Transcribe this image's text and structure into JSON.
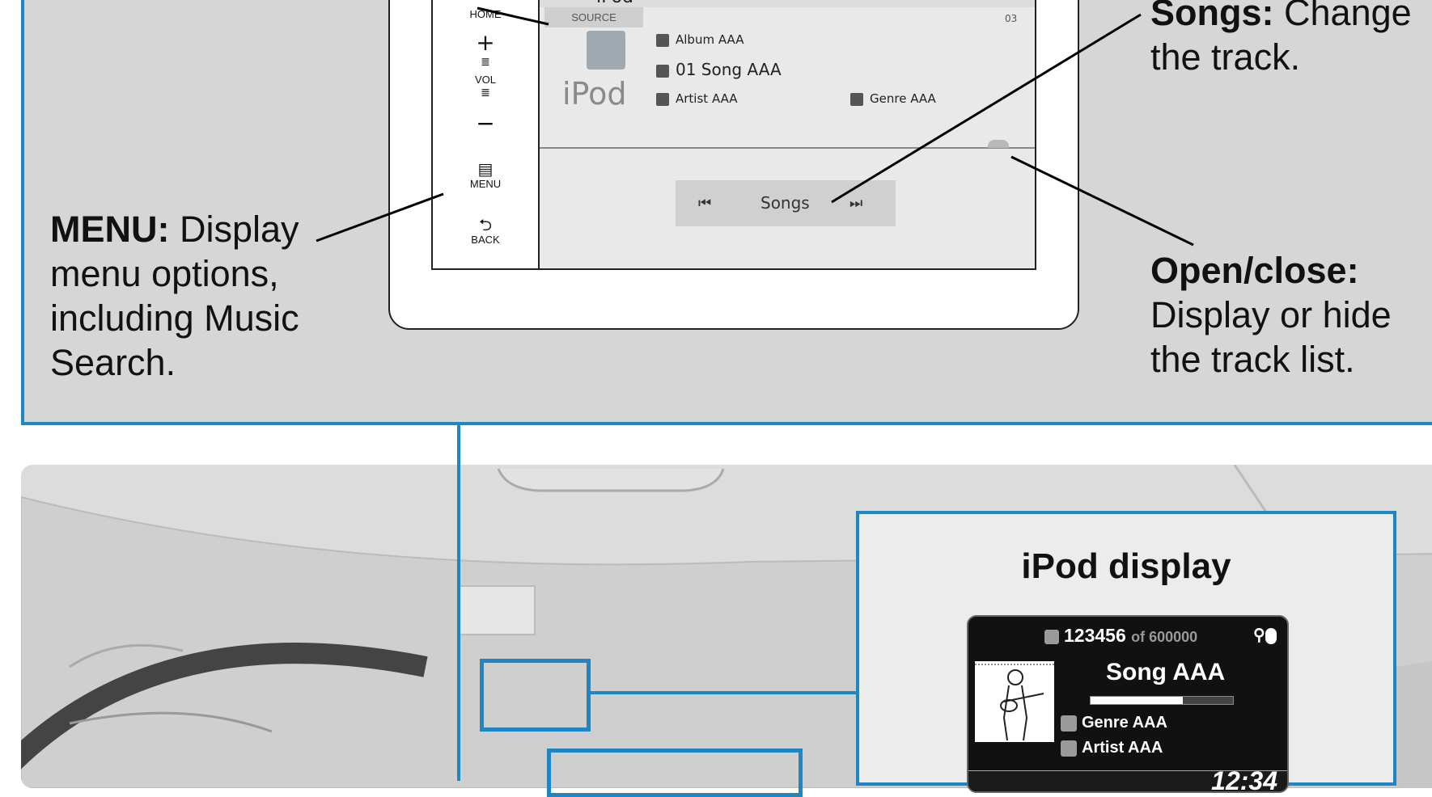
{
  "top_panel": {
    "menu_callout": {
      "term": "MENU:",
      "text": "Display menu options, including Music Search."
    },
    "songs_callout": {
      "term": "Songs:",
      "text": "Change the track."
    },
    "open_close_callout": {
      "term": "Open/close:",
      "text": "Display or hide the track list."
    }
  },
  "head_unit": {
    "side_buttons": {
      "home": "HOME",
      "vol_up": "+",
      "vol": "VOL",
      "vol_down": "−",
      "menu": "MENU",
      "back": "BACK"
    },
    "header_title": "iPod",
    "source_tab": "SOURCE",
    "volume_indicator": "03",
    "album": "Album AAA",
    "song": "01 Song AAA",
    "artist": "Artist AAA",
    "genre": "Genre AAA",
    "source_logo": "iPod",
    "songs_button": "Songs",
    "prev_icon": "⏮",
    "next_icon": "⏭"
  },
  "ipod_display": {
    "title": "iPod display",
    "track_number": "123456",
    "track_total": "of 600000",
    "song": "Song AAA",
    "genre": "Genre AAA",
    "artist": "Artist AAA",
    "clock": "12:34",
    "progress_fraction": 0.65
  },
  "colors": {
    "accent_blue": "#1f86c4",
    "panel_gray": "#d6d6d6"
  },
  "icons": [
    "usb-icon",
    "bluetooth-icon",
    "album-icon",
    "song-icon",
    "artist-icon",
    "genre-icon",
    "menu-icon",
    "back-icon"
  ]
}
